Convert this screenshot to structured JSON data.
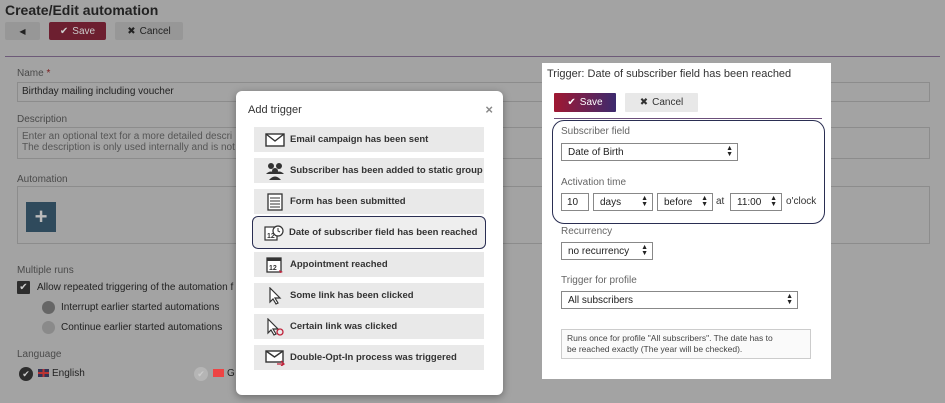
{
  "page": {
    "title": "Create/Edit automation",
    "toolbar": {
      "back_icon": "◀",
      "save_label": "Save",
      "cancel_label": "Cancel"
    }
  },
  "form": {
    "name_label": "Name",
    "name_required": "*",
    "name_value": "Birthday mailing including voucher",
    "description_label": "Description",
    "description_placeholder_line1": "Enter an optional text for a more detailed descri",
    "description_placeholder_line2": "The description is only used internally and is not",
    "automation_label": "Automation",
    "add_icon": "+",
    "multiple_runs_label": "Multiple runs",
    "allow_repeated_label": "Allow repeated triggering of the automation f",
    "interrupt_label": "Interrupt earlier started automations",
    "continue_label": "Continue earlier started automations",
    "language_label": "Language",
    "languages": [
      {
        "label": "English",
        "checked": true
      },
      {
        "label": "G",
        "checked": false
      }
    ]
  },
  "add_trigger_modal": {
    "title": "Add trigger",
    "close": "×",
    "items": [
      {
        "label": "Email campaign has been sent",
        "icon": "envelope-icon"
      },
      {
        "label": "Subscriber has been added to static group",
        "icon": "group-icon"
      },
      {
        "label": "Form has been submitted",
        "icon": "form-icon"
      },
      {
        "label": "Date of subscriber field has been reached",
        "icon": "calendar-clock-icon",
        "selected": true
      },
      {
        "label": "Appointment reached",
        "icon": "calendar-icon"
      },
      {
        "label": "Some link has been clicked",
        "icon": "cursor-icon"
      },
      {
        "label": "Certain link was clicked",
        "icon": "cursor-target-icon"
      },
      {
        "label": "Double-Opt-In process was triggered",
        "icon": "envelope-arrow-icon"
      }
    ]
  },
  "trigger_panel": {
    "title": "Trigger: Date of subscriber field has been reached",
    "save_label": "Save",
    "cancel_label": "Cancel",
    "subscriber_field_label": "Subscriber field",
    "subscriber_field_value": "Date of Birth",
    "activation_time_label": "Activation time",
    "activation_amount": "10",
    "activation_unit": "days",
    "activation_direction": "before",
    "at_text": "at",
    "activation_time": "11:00",
    "oclock_text": "o'clock",
    "recurrency_label": "Recurrency",
    "recurrency_value": "no recurrency",
    "trigger_for_profile_label": "Trigger for profile",
    "trigger_for_profile_value": "All subscribers",
    "info_line1": "Runs once for profile \"All subscribers\". The date has to",
    "info_line2": "be reached exactly (The year will be checked)."
  },
  "colors": {
    "accent": "#a01832",
    "accent_secondary": "#3c2a6e",
    "outline": "#2a2e52",
    "overlay": "#a3a3a3"
  }
}
